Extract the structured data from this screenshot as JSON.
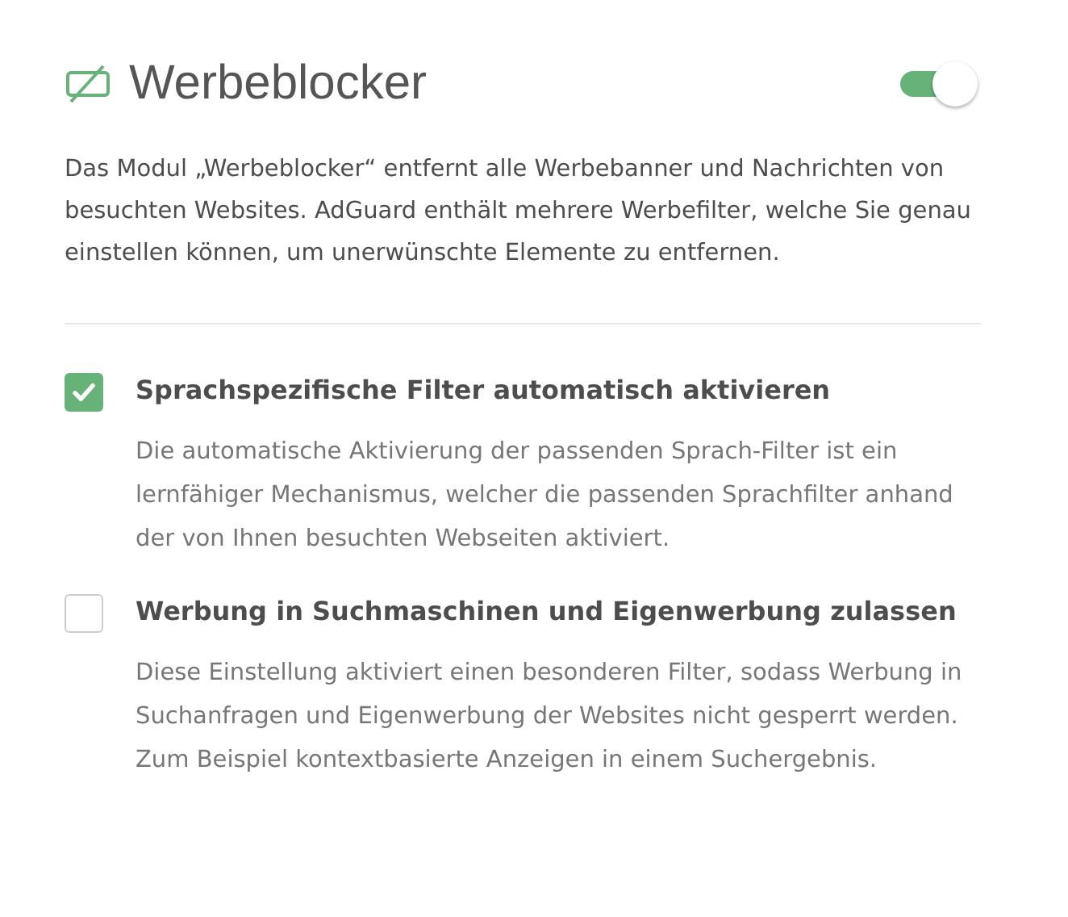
{
  "module": {
    "title": "Werbeblocker",
    "on": true,
    "description": "Das Modul „Werbeblocker“ entfernt alle Werbebanner und Nachrichten von besuchten Websites. AdGuard enthält mehrere Werbefilter, welche Sie genau einstellen können, um unerwünschte Elemente zu entfernen."
  },
  "options": [
    {
      "label": "Sprachspezifische Filter automatisch aktivieren",
      "checked": true,
      "description": "Die automatische Aktivierung der passenden Sprach-Filter ist ein lernfähiger Mechanismus, welcher die passenden Sprachfilter anhand der von Ihnen besuchten Webseiten aktiviert."
    },
    {
      "label": "Werbung in Suchmaschinen und Eigenwerbung zulassen",
      "checked": false,
      "description": "Diese Einstellung aktiviert einen besonderen Filter, sodass Werbung in Suchanfragen und Eigenwerbung der Websites nicht gesperrt werden. Zum Beispiel kontextbasierte Anzeigen in einem Suchergebnis."
    }
  ]
}
